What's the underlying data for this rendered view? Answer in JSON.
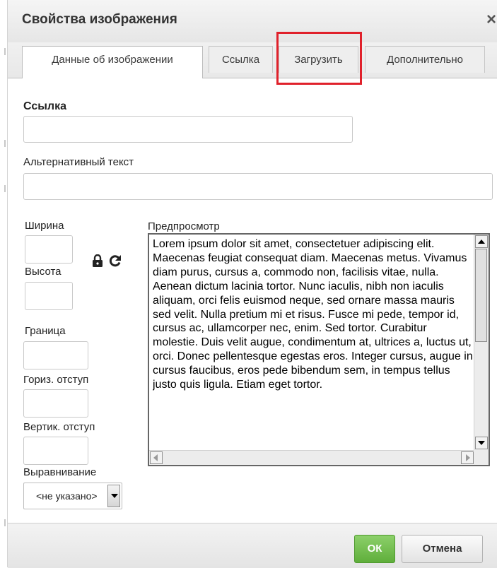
{
  "dialog": {
    "title": "Свойства изображения",
    "close_symbol": "×"
  },
  "tabs": [
    {
      "label": "Данные об изображении",
      "active": true
    },
    {
      "label": "Ссылка",
      "active": false
    },
    {
      "label": "Загрузить",
      "active": false
    },
    {
      "label": "Дополнительно",
      "active": false
    }
  ],
  "form": {
    "url_label": "Ссылка",
    "url_value": "",
    "alt_label": "Альтернативный текст",
    "alt_value": "",
    "width_label": "Ширина",
    "height_label": "Высота",
    "border_label": "Граница",
    "hspace_label": "Гориз. отступ",
    "vspace_label": "Вертик. отступ",
    "align_label": "Выравнивание",
    "align_value": "<не указано>",
    "lock_icon": "lock-icon",
    "reset_icon": "reset-size-icon"
  },
  "preview": {
    "label": "Предпросмотр",
    "text": "Lorem ipsum dolor sit amet, consectetuer adipiscing elit. Maecenas feugiat consequat diam. Maecenas metus. Vivamus diam purus, cursus a, commodo non, facilisis vitae, nulla. Aenean dictum lacinia tortor. Nunc iaculis, nibh non iaculis aliquam, orci felis euismod neque, sed ornare massa mauris sed velit. Nulla pretium mi et risus. Fusce mi pede, tempor id, cursus ac, ullamcorper nec, enim. Sed tortor. Curabitur molestie. Duis velit augue, condimentum at, ultrices a, luctus ut, orci. Donec pellentesque egestas eros. Integer cursus, augue in cursus faucibus, eros pede bibendum sem, in tempus tellus justo quis ligula. Etiam eget tortor."
  },
  "footer": {
    "ok_label": "ОК",
    "cancel_label": "Отмена"
  },
  "colors": {
    "highlight": "#e0212b",
    "ok_button": "#6ebd47"
  }
}
